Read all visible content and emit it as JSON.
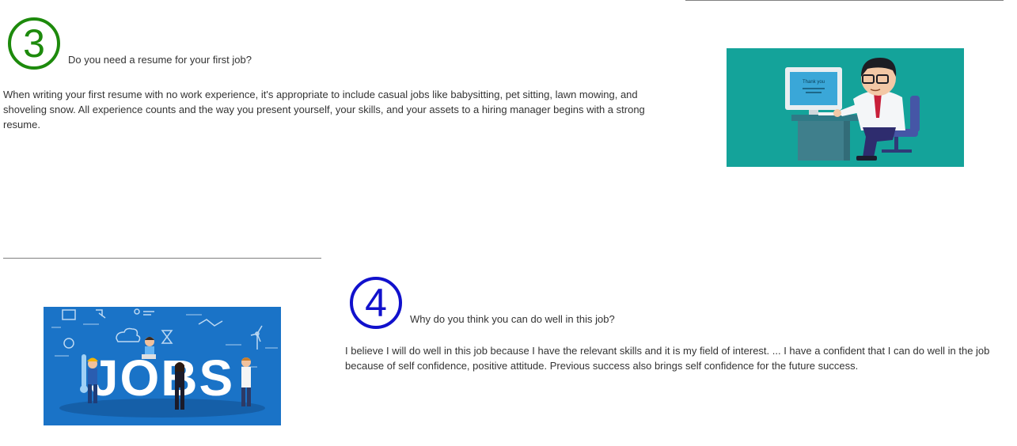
{
  "sections": [
    {
      "number": "3",
      "number_color": "#1d8a0c",
      "question": "Do you need a resume for your first job?",
      "answer": "When writing your first resume with no work experience, it's appropriate to include casual jobs like babysitting, pet sitting, lawn mowing, and shoveling snow. All experience counts and the way you present yourself, your skills, and your assets to a hiring manager begins with a strong resume.",
      "illustration": {
        "name": "man-at-computer-illustration",
        "background": "#14a39a",
        "screen_text": "Thank you"
      }
    },
    {
      "number": "4",
      "number_color": "#1111cc",
      "question": "Why do you think you can do well in this job?",
      "answer": "I believe I will do well in this job because I have the relevant skills and it is my field of interest. ... I have a confident that I can do well in the job because of self confidence, positive attitude. Previous success also brings self confidence for the future success.",
      "illustration": {
        "name": "jobs-illustration",
        "background": "#1a73c7",
        "word": "JOBS"
      }
    }
  ]
}
